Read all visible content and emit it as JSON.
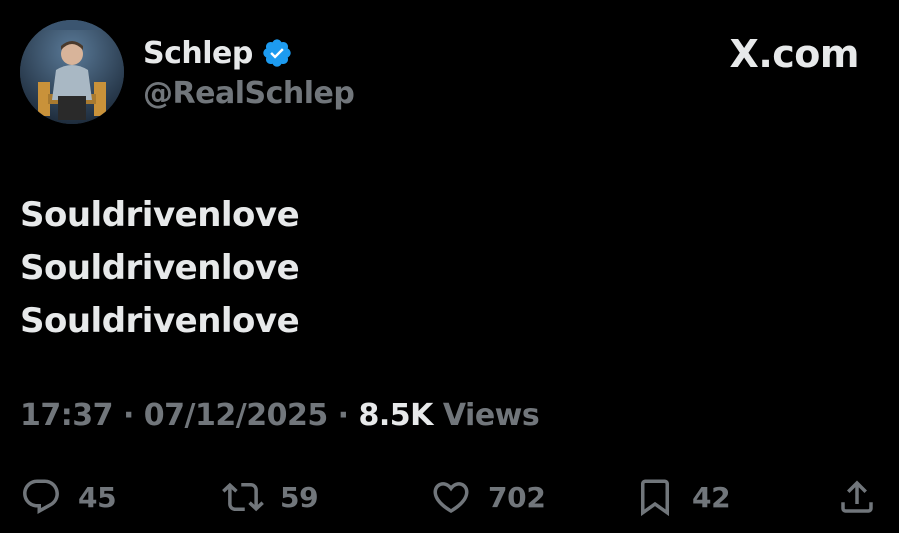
{
  "author": {
    "display_name": "Schlep",
    "handle": "@RealSchlep",
    "verified": true
  },
  "brand": {
    "label": "X.com"
  },
  "tweet": {
    "lines": [
      "Souldrivenlove",
      "Souldrivenlove",
      "Souldrivenlove"
    ]
  },
  "meta": {
    "time": "17:37",
    "separator": " · ",
    "date": "07/12/2025",
    "views_count": "8.5K",
    "views_label": " Views"
  },
  "actions": {
    "replies": "45",
    "reposts": "59",
    "likes": "702",
    "bookmarks": "42"
  },
  "icons": {
    "verified": "verified-badge-icon",
    "reply": "reply-icon",
    "repost": "repost-icon",
    "like": "heart-icon",
    "bookmark": "bookmark-icon",
    "share": "share-icon"
  },
  "colors": {
    "background": "#000000",
    "primary_text": "#e7e9ea",
    "secondary_text": "#71767b",
    "verified_blue": "#1d9bf0"
  }
}
